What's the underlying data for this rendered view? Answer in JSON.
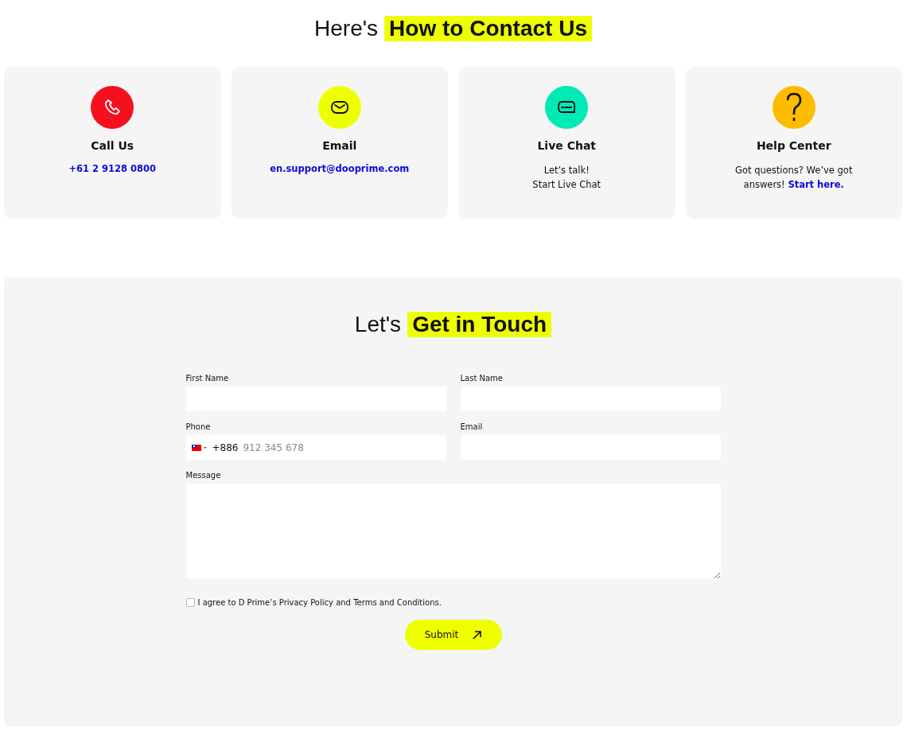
{
  "contact_heading": {
    "prefix": "Here's",
    "highlight": "How to Contact Us"
  },
  "cards": [
    {
      "kind": "phone",
      "color": "#f5101d",
      "title": "Call Us",
      "link": "+61 2 9128 0800"
    },
    {
      "kind": "email",
      "color": "#eeff00",
      "title": "Email",
      "link": "en.support@dooprime.com"
    },
    {
      "kind": "chat",
      "color": "#00eab5",
      "title": "Live Chat",
      "lines": [
        "Let’s talk!",
        "Start Live Chat"
      ]
    },
    {
      "kind": "help",
      "color": "#ffbb00",
      "title": "Help Center",
      "text": "Got questions? We’ve got answers!",
      "link": "Start here."
    }
  ],
  "form_heading": {
    "prefix": "Let's",
    "highlight": "Get in Touch"
  },
  "fields": [
    {
      "kind": "text",
      "label": "First Name"
    },
    {
      "kind": "text",
      "label": "Last Name"
    },
    {
      "kind": "phone",
      "label": "Phone",
      "code": "+886",
      "placeholder": "912 345 678"
    },
    {
      "kind": "text",
      "label": "Email"
    },
    {
      "kind": "textarea",
      "label": "Message"
    }
  ],
  "consent": {
    "checked": false,
    "before": "I agree to D Prime’s",
    "link_1": "Privacy Policy",
    "middle": "and",
    "link_2": "Terms and Conditions",
    "after": "."
  },
  "submit": {
    "label": "Submit"
  }
}
